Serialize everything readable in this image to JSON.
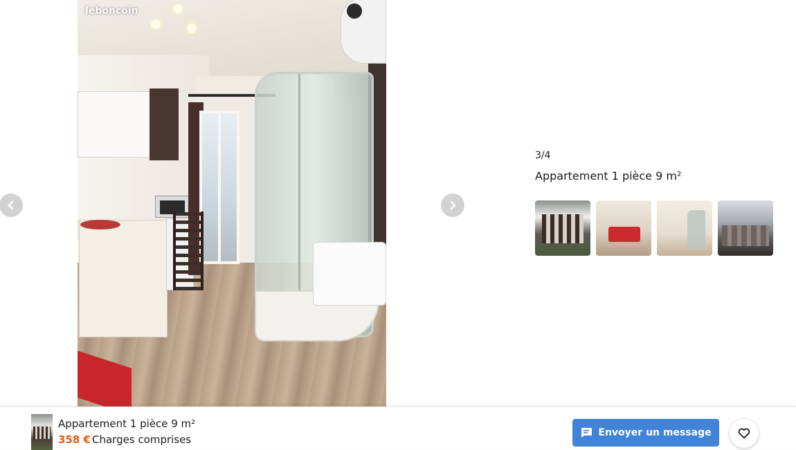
{
  "photo": {
    "watermark": "leboncoin",
    "alt": "Appartement 1 pièce 9 m²"
  },
  "carousel": {
    "prev_icon": "chevron-left-icon",
    "next_icon": "chevron-right-icon"
  },
  "info": {
    "counter": "3/4",
    "title": "Appartement 1 pièce 9 m²",
    "thumbnails": [
      {
        "label": "photo 1"
      },
      {
        "label": "photo 2"
      },
      {
        "label": "photo 3"
      },
      {
        "label": "photo 4"
      }
    ]
  },
  "bottom_bar": {
    "title": "Appartement 1 pièce 9 m²",
    "price": "358 €",
    "charges": "Charges comprises",
    "message_button": "Envoyer un message",
    "message_icon": "chat-bubble-icon",
    "favorite_icon": "heart-icon"
  },
  "colors": {
    "price": "#ec5a13",
    "button": "#4183d7",
    "arrow_bg": "#d2d2d2"
  }
}
